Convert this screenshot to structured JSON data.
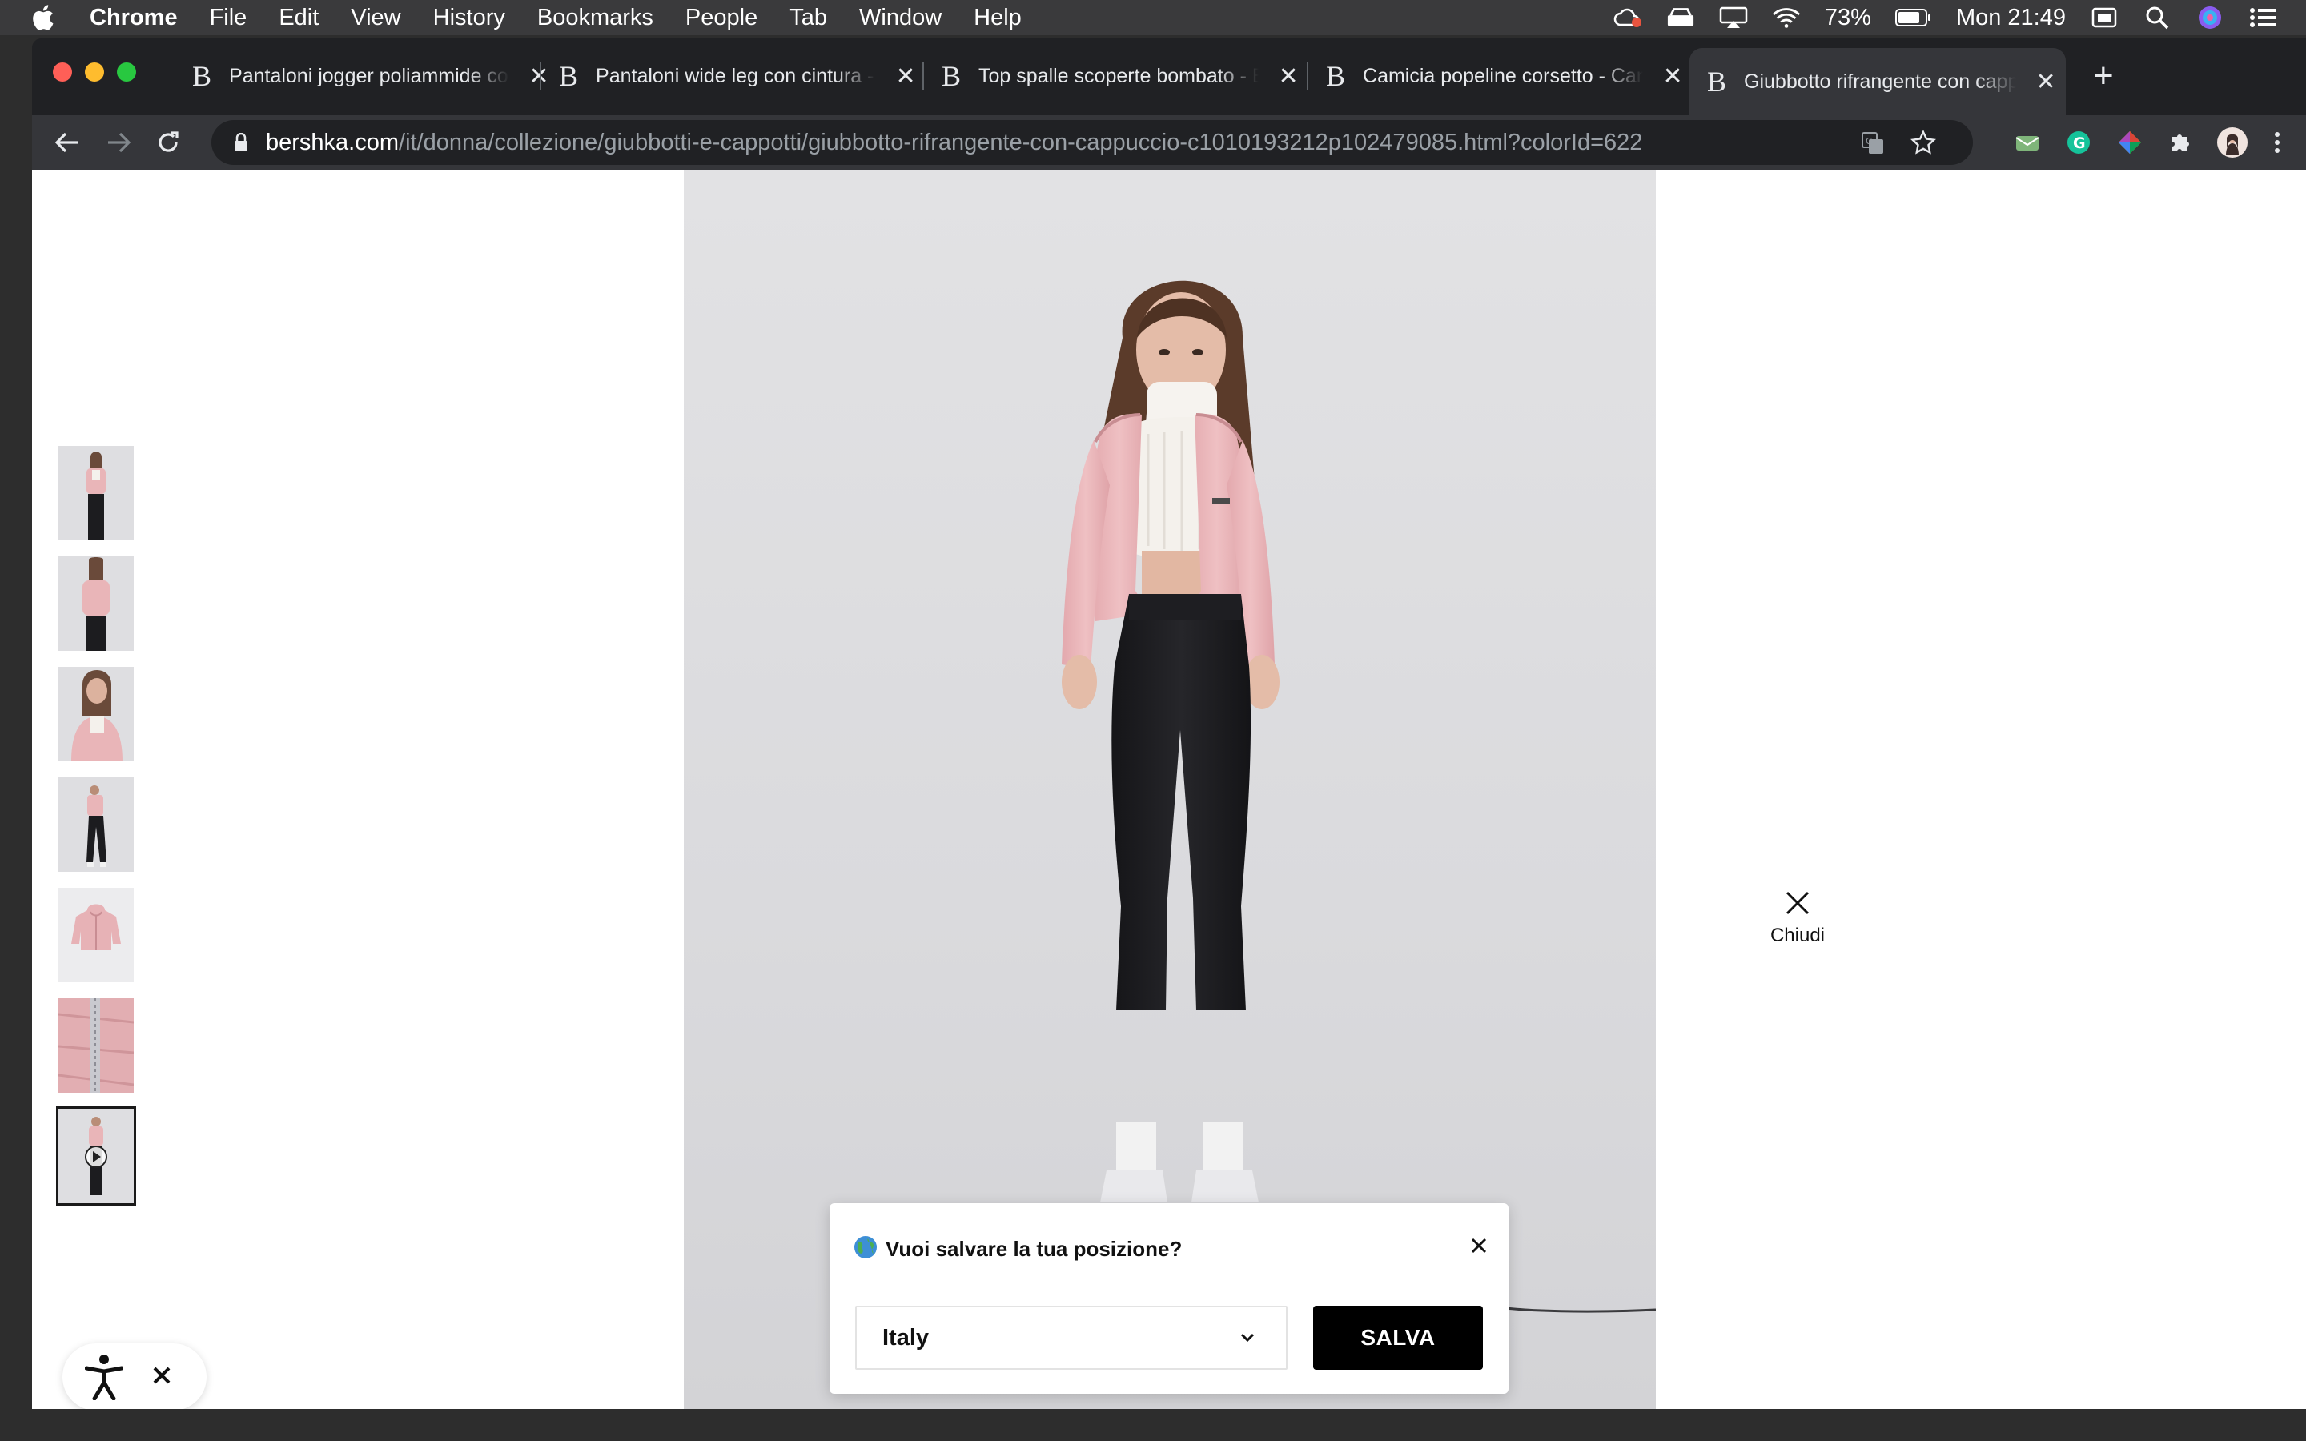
{
  "menubar": {
    "app": "Chrome",
    "items": [
      "File",
      "Edit",
      "View",
      "History",
      "Bookmarks",
      "People",
      "Tab",
      "Window",
      "Help"
    ],
    "battery": "73%",
    "clock": "Mon 21:49"
  },
  "tabs": [
    {
      "favicon": "B",
      "title": "Pantaloni jogger poliammide con elastico"
    },
    {
      "favicon": "B",
      "title": "Pantaloni wide leg con cintura - Bershka"
    },
    {
      "favicon": "B",
      "title": "Top spalle scoperte bombato - Bershka"
    },
    {
      "favicon": "B",
      "title": "Camicia popeline corsetto - Camicie"
    },
    {
      "favicon": "B",
      "title": "Giubbotto rifrangente con cappuccio"
    }
  ],
  "new_tab_label": "+",
  "address": {
    "domain": "bershka.com",
    "path": "/it/donna/collezione/giubbotti-e-cappotti/giubbotto-rifrangente-con-cappuccio-c1010193212p102479085.html?colorId=622"
  },
  "viewer": {
    "close_label": "Chiudi",
    "thumbnails": [
      "front",
      "back",
      "closeup",
      "full-body",
      "jacket-flat",
      "fabric-detail",
      "video"
    ]
  },
  "location_dialog": {
    "question": "Vuoi salvare la tua posizione?",
    "selected_country": "Italy",
    "save_label": "SALVA"
  },
  "colors": {
    "accent": "#000000",
    "jacket": "#e9b5b8",
    "trousers": "#1c1c1f",
    "backdrop": "#dedee0"
  }
}
